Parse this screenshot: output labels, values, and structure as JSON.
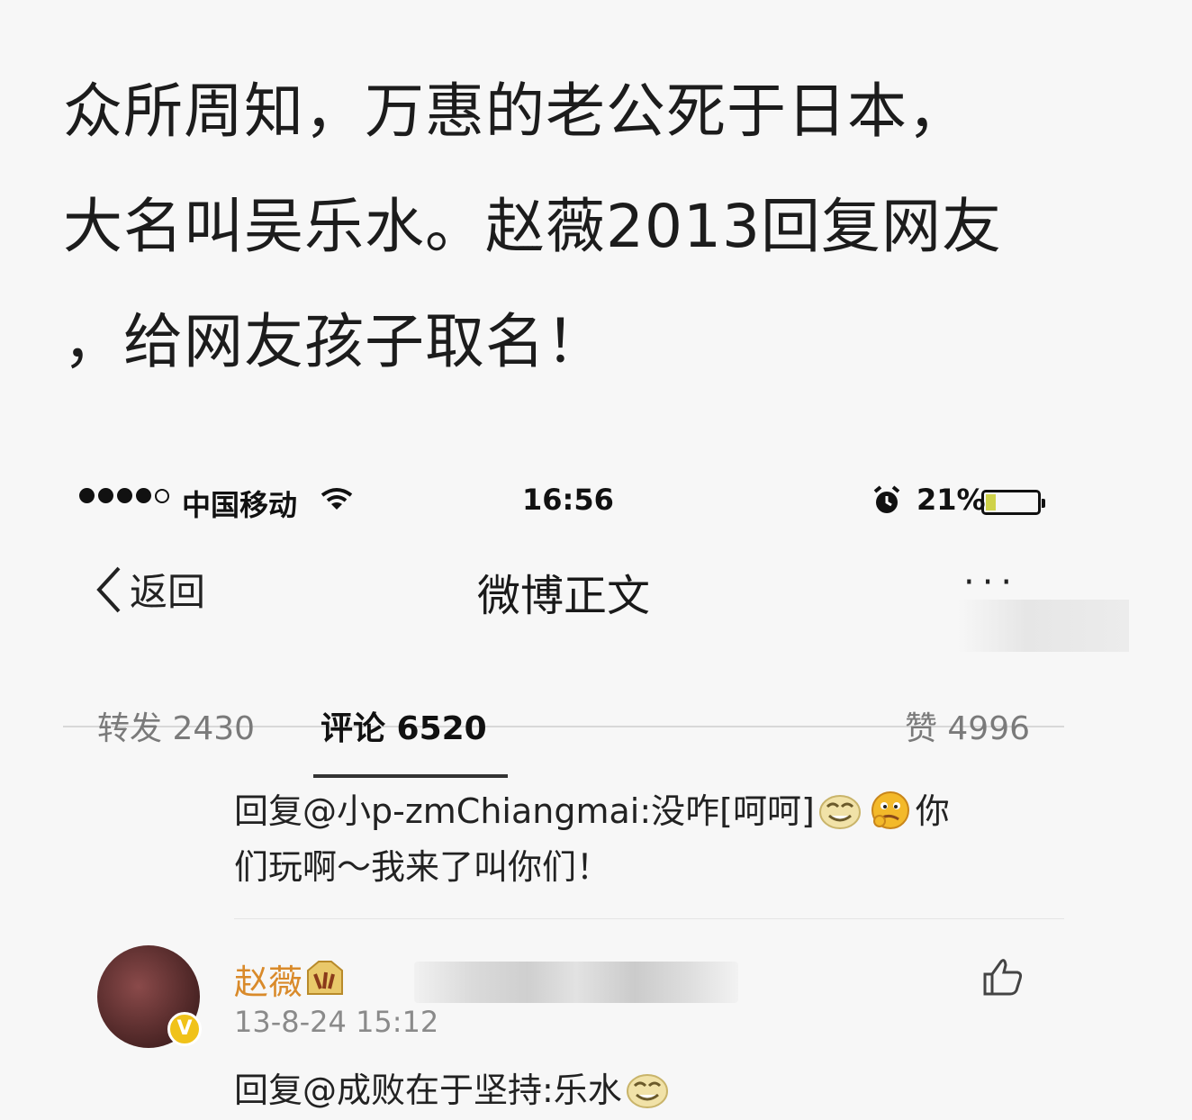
{
  "headline": {
    "line1": "众所周知，万惠的老公死于日本，",
    "line2": "大名叫吴乐水。赵薇2013回复网友",
    "line3": "，给网友孩子取名！"
  },
  "status_bar": {
    "carrier": "中国移动",
    "time": "16:56",
    "battery_percent": "21%",
    "battery_level": 0.21
  },
  "nav": {
    "back_label": "返回",
    "title": "微博正文",
    "more_label": "···"
  },
  "tabs": {
    "repost": "转发 2430",
    "comment": "评论 6520",
    "like": "赞 4996"
  },
  "comment1": {
    "line1_text": "回复@小p-zmChiangmai:没咋[呵呵]",
    "line1_tail": "你",
    "line2": "们玩啊～我来了叫你们！"
  },
  "comment2": {
    "username": "赵薇",
    "timestamp": "13-8-24 15:12",
    "text": "回复@成败在于坚持:乐水",
    "verified_badge": "V"
  },
  "colors": {
    "username": "#d98a2a",
    "badge": "#f0c21a"
  }
}
